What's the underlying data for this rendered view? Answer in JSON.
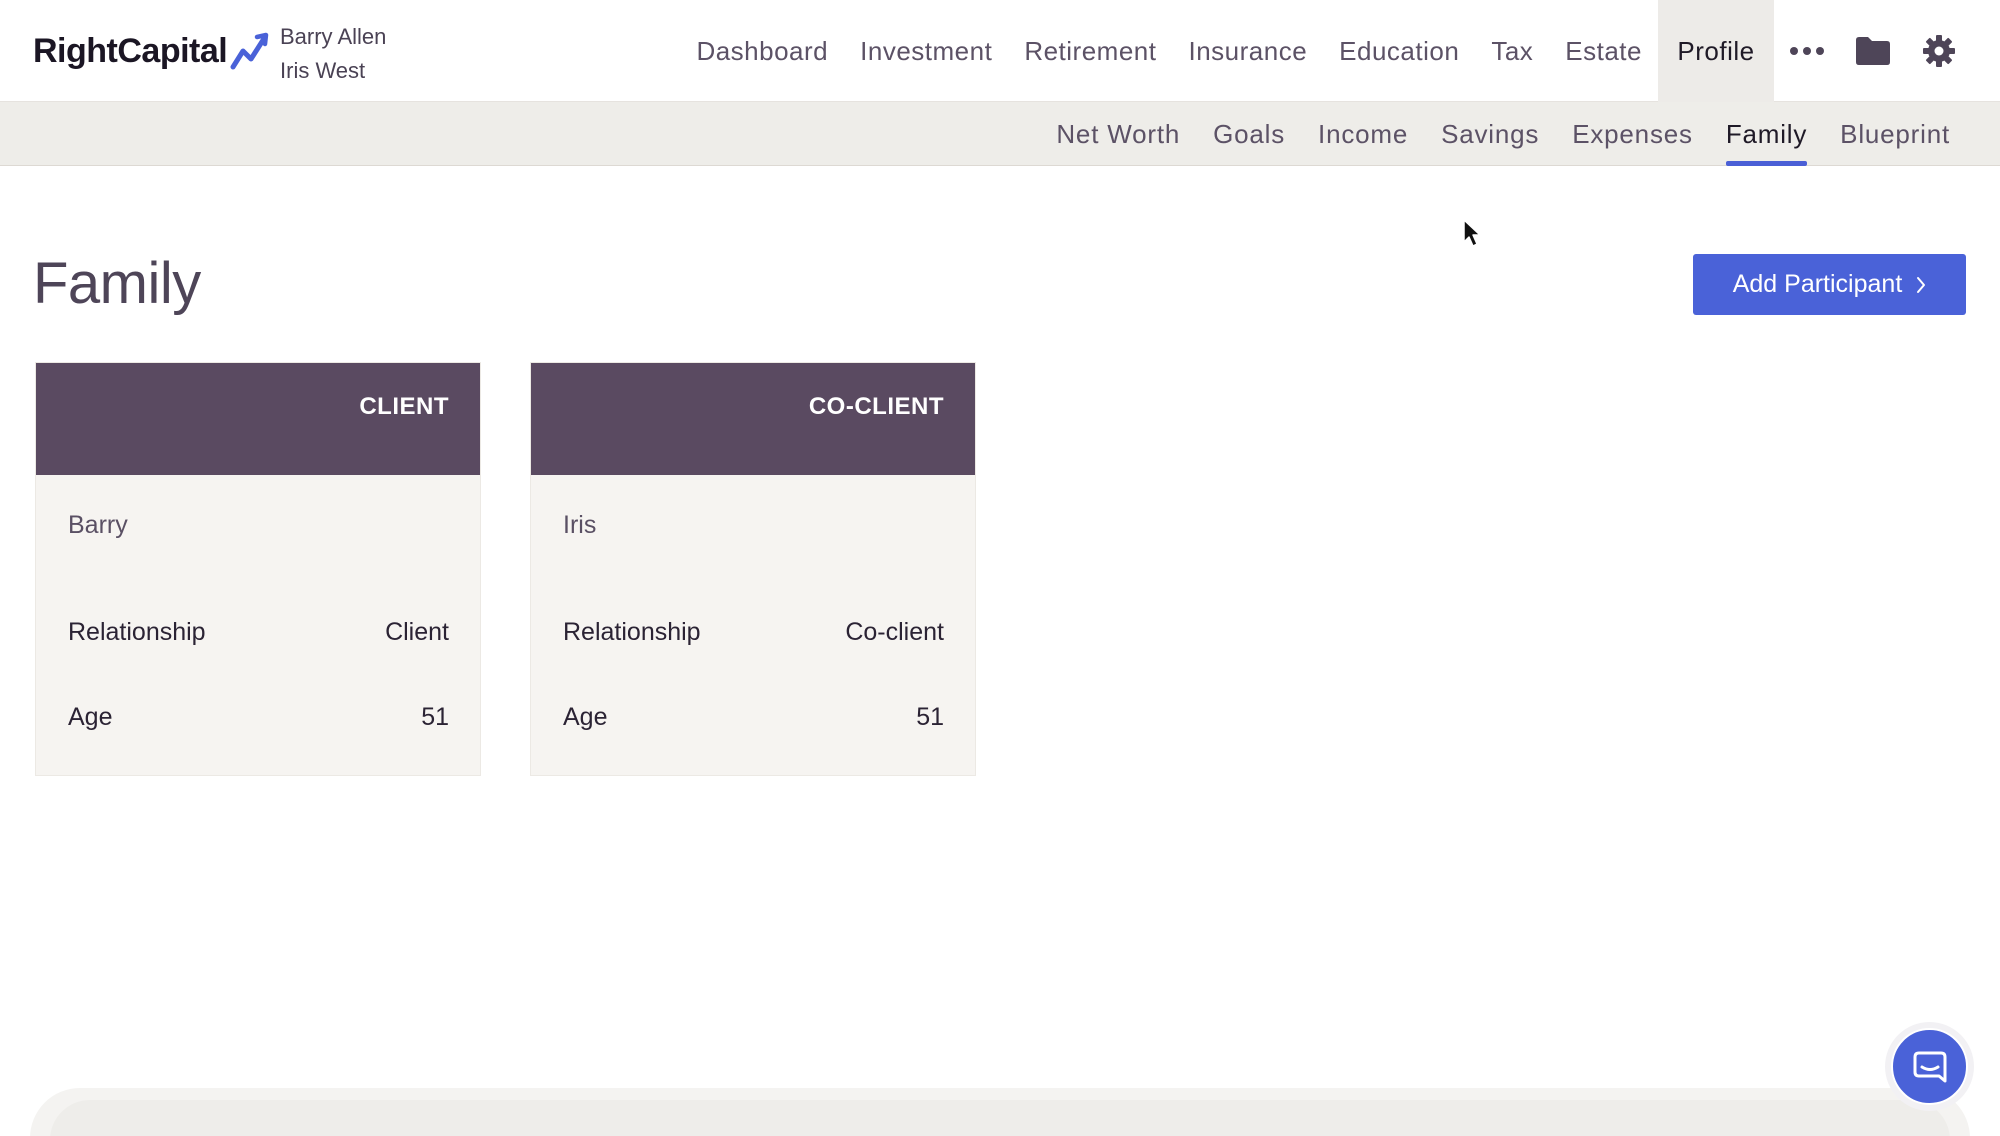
{
  "brand": {
    "name": "RightCapital",
    "logo_icon": "rising-arrow-icon",
    "accent_color": "#4a62d8"
  },
  "clients": {
    "client": "Barry Allen",
    "co_client": "Iris West"
  },
  "main_nav": {
    "items": [
      {
        "label": "Dashboard"
      },
      {
        "label": "Investment"
      },
      {
        "label": "Retirement"
      },
      {
        "label": "Insurance"
      },
      {
        "label": "Education"
      },
      {
        "label": "Tax"
      },
      {
        "label": "Estate"
      },
      {
        "label": "Profile",
        "active": true
      }
    ],
    "icons": [
      "more-icon",
      "folder-icon",
      "gear-icon"
    ]
  },
  "sub_nav": {
    "items": [
      {
        "label": "Net Worth"
      },
      {
        "label": "Goals"
      },
      {
        "label": "Income"
      },
      {
        "label": "Savings"
      },
      {
        "label": "Expenses"
      },
      {
        "label": "Family",
        "active": true
      },
      {
        "label": "Blueprint"
      }
    ]
  },
  "page": {
    "title": "Family",
    "add_button_label": "Add Participant"
  },
  "cards": [
    {
      "role": "CLIENT",
      "name": "Barry",
      "relationship_label": "Relationship",
      "relationship": "Client",
      "age_label": "Age",
      "age": "51"
    },
    {
      "role": "CO-CLIENT",
      "name": "Iris",
      "relationship_label": "Relationship",
      "relationship": "Co-client",
      "age_label": "Age",
      "age": "51"
    }
  ],
  "colors": {
    "card_header": "#5a4a61",
    "card_body": "#f6f4f1",
    "subnav_bg": "#eeede9",
    "active_underline": "#4a5fd6"
  },
  "chat": {
    "icon": "chat-icon"
  }
}
